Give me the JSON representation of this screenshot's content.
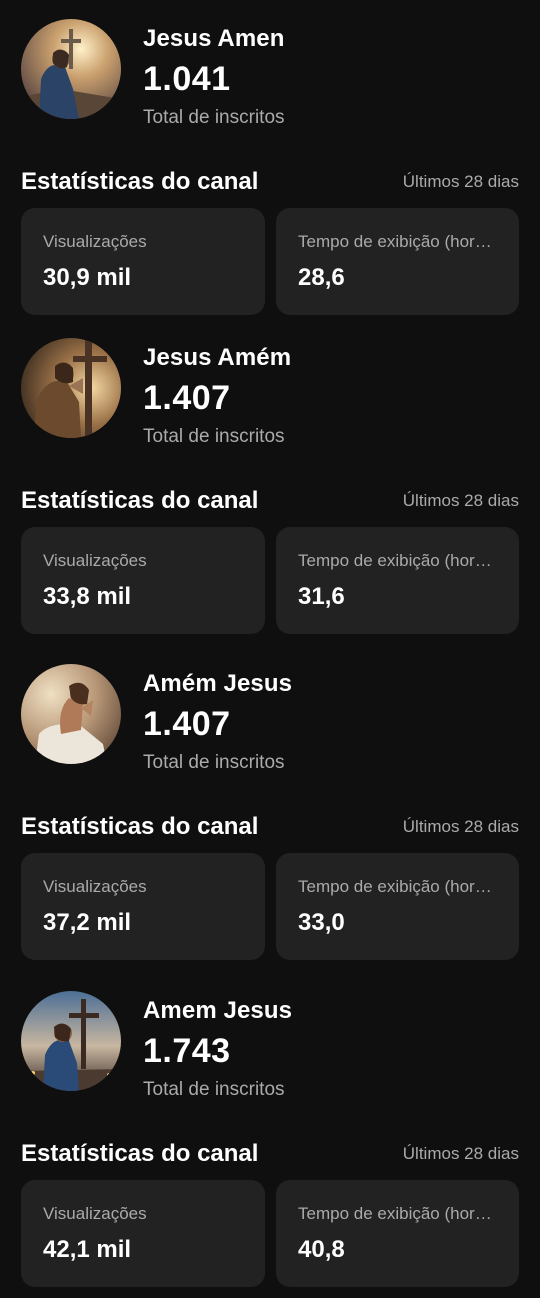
{
  "channels": [
    {
      "name": "Jesus Amen",
      "subscribers": "1.041",
      "subscribers_label": "Total de inscritos",
      "stats_title": "Estatísticas do canal",
      "stats_period": "Últimos 28 dias",
      "views_label": "Visualizações",
      "views_value": "30,9 mil",
      "watch_label": "Tempo de exibição (horas)",
      "watch_value": "28,6"
    },
    {
      "name": "Jesus Amém",
      "subscribers": "1.407",
      "subscribers_label": "Total de inscritos",
      "stats_title": "Estatísticas do canal",
      "stats_period": "Últimos 28 dias",
      "views_label": "Visualizações",
      "views_value": "33,8 mil",
      "watch_label": "Tempo de exibição (horas)",
      "watch_value": "31,6"
    },
    {
      "name": "Amém Jesus",
      "subscribers": "1.407",
      "subscribers_label": "Total de inscritos",
      "stats_title": "Estatísticas do canal",
      "stats_period": "Últimos 28 dias",
      "views_label": "Visualizações",
      "views_value": "37,2 mil",
      "watch_label": "Tempo de exibição (horas)",
      "watch_value": "33,0"
    },
    {
      "name": "Amem Jesus",
      "subscribers": "1.743",
      "subscribers_label": "Total de inscritos",
      "stats_title": "Estatísticas do canal",
      "stats_period": "Últimos 28 dias",
      "views_label": "Visualizações",
      "views_value": "42,1 mil",
      "watch_label": "Tempo de exibição (horas)",
      "watch_value": "40,8"
    }
  ],
  "theme": {
    "background": "#0f0f0f",
    "card": "#222222",
    "text_primary": "#ffffff",
    "text_secondary": "#aaaaaa"
  },
  "icons": [
    "channel-avatar-praying-figure"
  ]
}
